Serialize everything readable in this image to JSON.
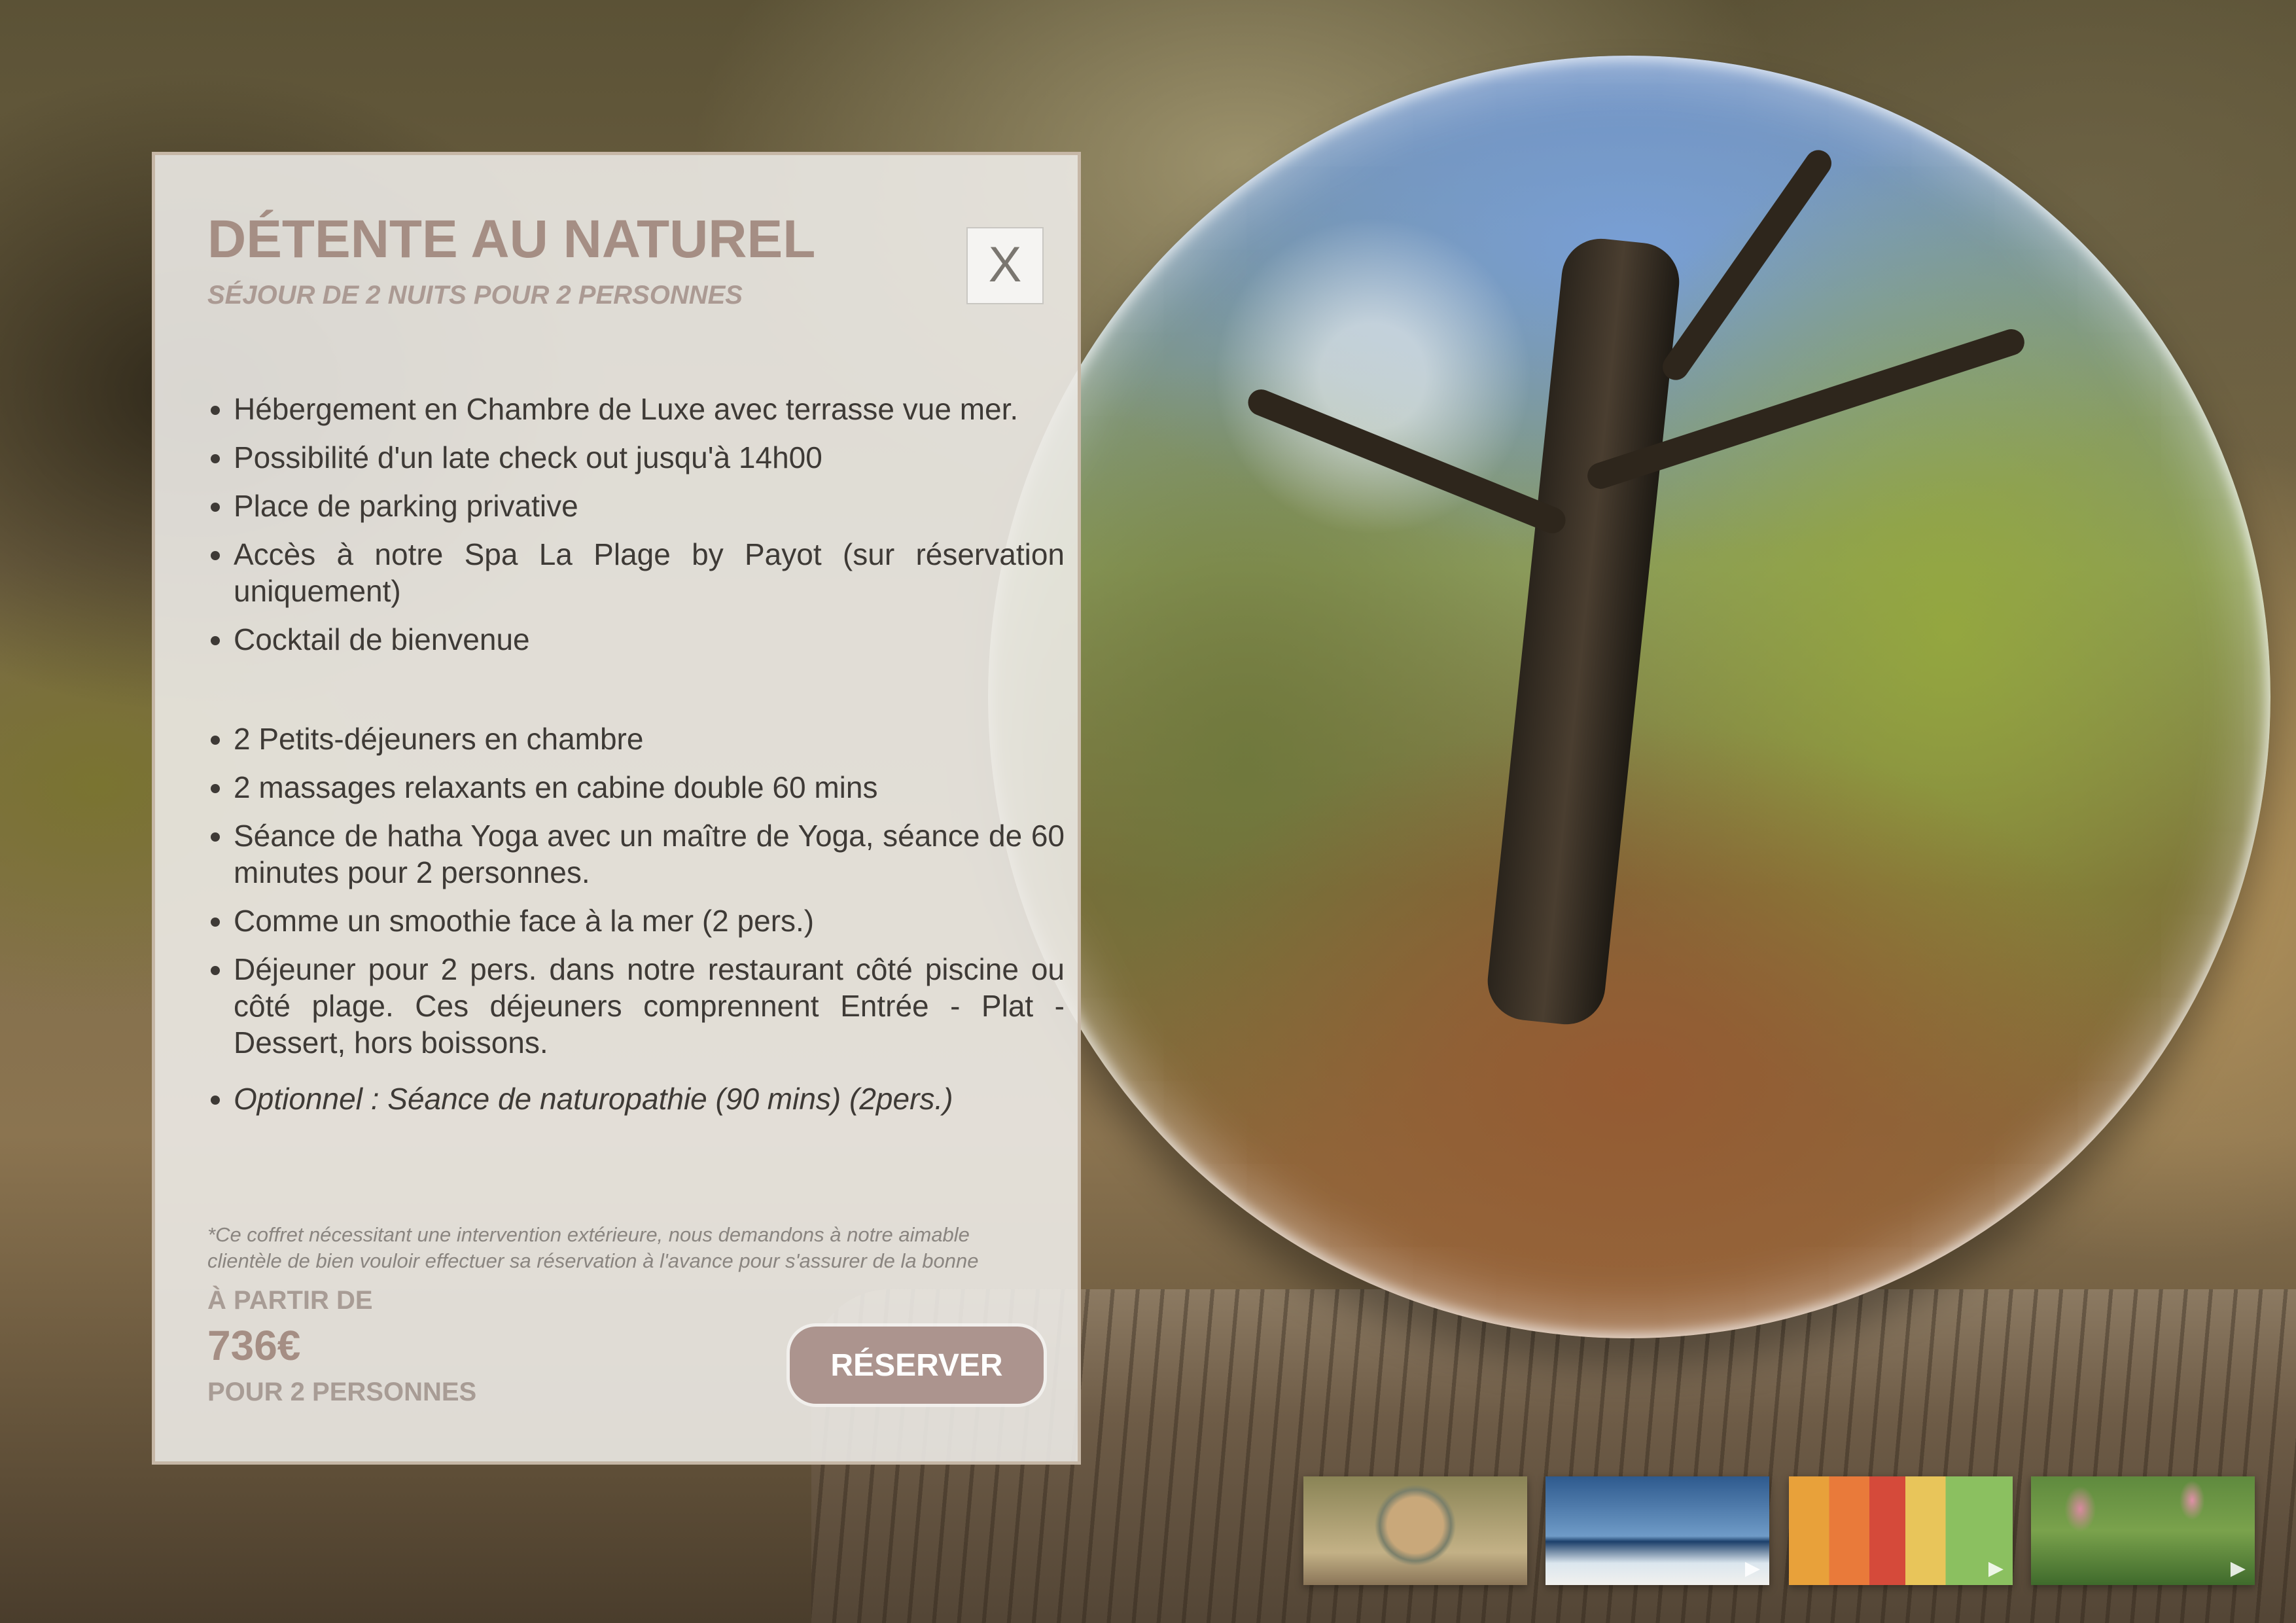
{
  "offer": {
    "title": "DÉTENTE AU NATUREL",
    "subtitle": "SÉJOUR DE 2 NUITS POUR 2 PERSONNES",
    "close_label": "X",
    "features": [
      "Hébergement en Chambre de Luxe avec terrasse vue mer.",
      "Possibilité d'un late check out  jusqu'à 14h00",
      "Place de parking privative",
      "Accès à notre Spa La Plage by Payot (sur réservation uniquement)",
      "Cocktail de bienvenue",
      "2 Petits-déjeuners en chambre",
      "2 massages relaxants en cabine double 60 mins",
      "Séance de hatha Yoga avec un maître de Yoga, séance de 60 minutes pour 2 personnes.",
      "Comme un smoothie face à la mer (2 pers.)",
      "Déjeuner pour 2 pers. dans notre restaurant côté piscine ou côté plage. Ces déjeuners comprennent Entrée - Plat - Dessert, hors boissons.",
      "Optionnel : Séance de naturopathie (90 mins) (2pers.)"
    ],
    "note": "*Ce coffret nécessitant une intervention extérieure, nous demandons à notre aimable clientèle de bien vouloir effectuer sa réservation à l'avance pour s'assurer de la bonne",
    "price_prefix": "À PARTIR DE",
    "price": "736€",
    "price_suffix": "POUR 2 PERSONNES",
    "reserve_label": "RÉSERVER"
  },
  "gallery": {
    "play_icon": "▶",
    "thumbnails": [
      {
        "name": "thumbnail-crystal-ball"
      },
      {
        "name": "thumbnail-yoga-sea"
      },
      {
        "name": "thumbnail-smoothies"
      },
      {
        "name": "thumbnail-flowers"
      }
    ]
  },
  "colors": {
    "title": "#a58e84",
    "button": "#ac948e",
    "panel_border": "#c6b7a6"
  }
}
